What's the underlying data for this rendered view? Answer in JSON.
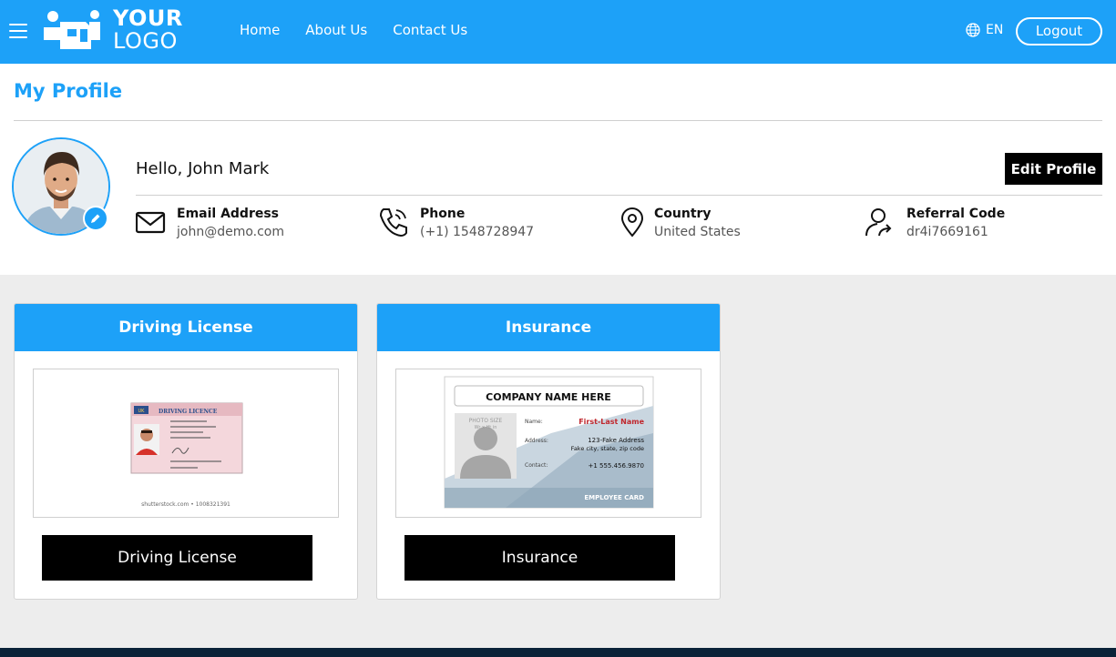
{
  "header": {
    "logo_line1": "YOUR",
    "logo_line2": "LOGO",
    "nav": [
      "Home",
      "About Us",
      "Contact Us"
    ],
    "language": "EN",
    "logout_label": "Logout",
    "background_color": "#1da1f8"
  },
  "profile": {
    "page_title": "My Profile",
    "greeting": "Hello, John Mark",
    "edit_label": "Edit Profile",
    "fields": [
      {
        "label": "Email Address",
        "value": "john@demo.com",
        "icon": "envelope-icon"
      },
      {
        "label": "Phone",
        "value": "(+1) 1548728947",
        "icon": "phone-icon"
      },
      {
        "label": "Country",
        "value": "United States",
        "icon": "map-pin-icon"
      },
      {
        "label": "Referral Code",
        "value": "dr4i7669161",
        "icon": "user-share-icon"
      }
    ]
  },
  "cards": [
    {
      "title": "Driving License",
      "button_label": "Driving License",
      "doc": {
        "heading": "DRIVING LICENCE",
        "badge": "UK",
        "watermark": "shutterstock.com • 1008321391"
      }
    },
    {
      "title": "Insurance",
      "button_label": "Insurance",
      "doc": {
        "company": "COMPANY NAME HERE",
        "photo_label": "PHOTO SIZE",
        "photo_sub": "Wr x Ht in",
        "name_label": "Name:",
        "name_value": "First-Last Name",
        "address_label": "Address:",
        "address_line1": "123-Fake Address",
        "address_line2": "Fake city, state, zip code",
        "contact_label": "Contact:",
        "contact_value": "+1 555.456.9870",
        "footer": "EMPLOYEE CARD"
      }
    }
  ],
  "colors": {
    "accent": "#1da1f8",
    "button": "#000000",
    "page_bg": "#ededed",
    "footer": "#0a2238"
  }
}
